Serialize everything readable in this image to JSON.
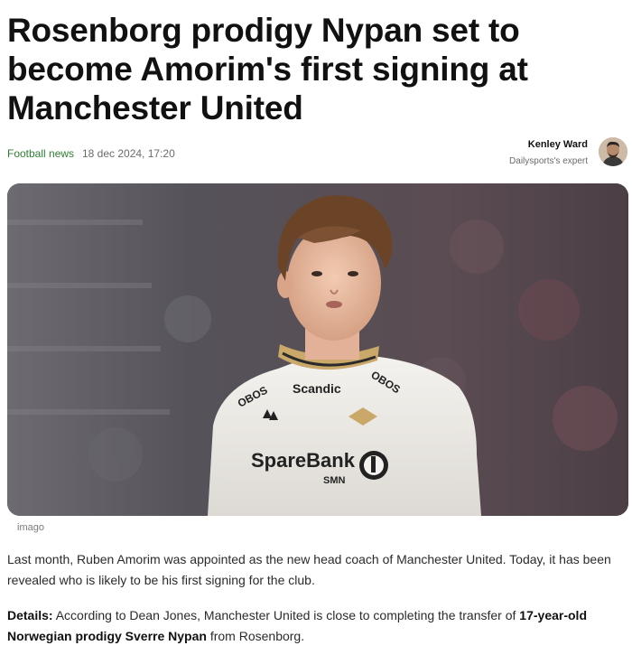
{
  "article": {
    "headline": "Rosenborg prodigy Nypan set to become Amorim's first signing at Manchester United",
    "category": "Football news",
    "date": "18 dec 2024, 17:20",
    "author": {
      "name": "Kenley Ward",
      "role": "Dailysports's expert"
    },
    "image": {
      "credit": "imago",
      "shirt_sponsor": "Scandic",
      "shirt_bank": "SpareBank",
      "shirt_bank_sub": "SMN",
      "shirt_obos": "OBOS"
    },
    "paragraph1": "Last month, Ruben Amorim was appointed as the new head coach of Manchester United. Today, it has been revealed who is likely to be his first signing for the club.",
    "paragraph2": {
      "label": "Details:",
      "text_before": " According to Dean Jones, Manchester United is close to completing the transfer of ",
      "bold": "17-year-old Norwegian prodigy Sverre Nypan",
      "text_after": " from Rosenborg."
    }
  }
}
